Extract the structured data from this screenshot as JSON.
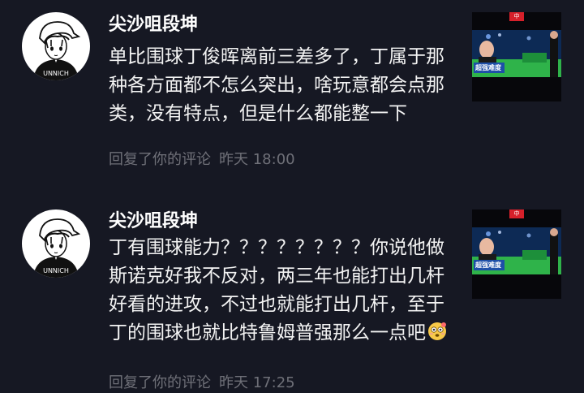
{
  "notifications": [
    {
      "username": "尖沙咀段坤",
      "avatar_shirt_text": "UNNICH",
      "comment": "单比围球丁俊晖离前三差多了，丁属于那种各方面都不怎么突出，啥玩意都会点那类，没有特点，但是什么都能整一下",
      "emoji": "",
      "action": "回复了你的评论",
      "time": "昨天 18:00",
      "thumbnail": {
        "badge": "中",
        "caption": "超强难度"
      }
    },
    {
      "username": "尖沙咀段坤",
      "avatar_shirt_text": "UNNICH",
      "comment": "丁有围球能力？？？？？？？？你说他做斯诺克好我不反对，两三年也能打出几杆好看的进攻，不过也就能打出几杆，至于丁的围球也就比特鲁姆普强那么一点吧",
      "emoji": "dizzy-face-emoji",
      "action": "回复了你的评论",
      "time": "昨天 17:25",
      "thumbnail": {
        "badge": "中",
        "caption": "超强难度"
      }
    }
  ]
}
